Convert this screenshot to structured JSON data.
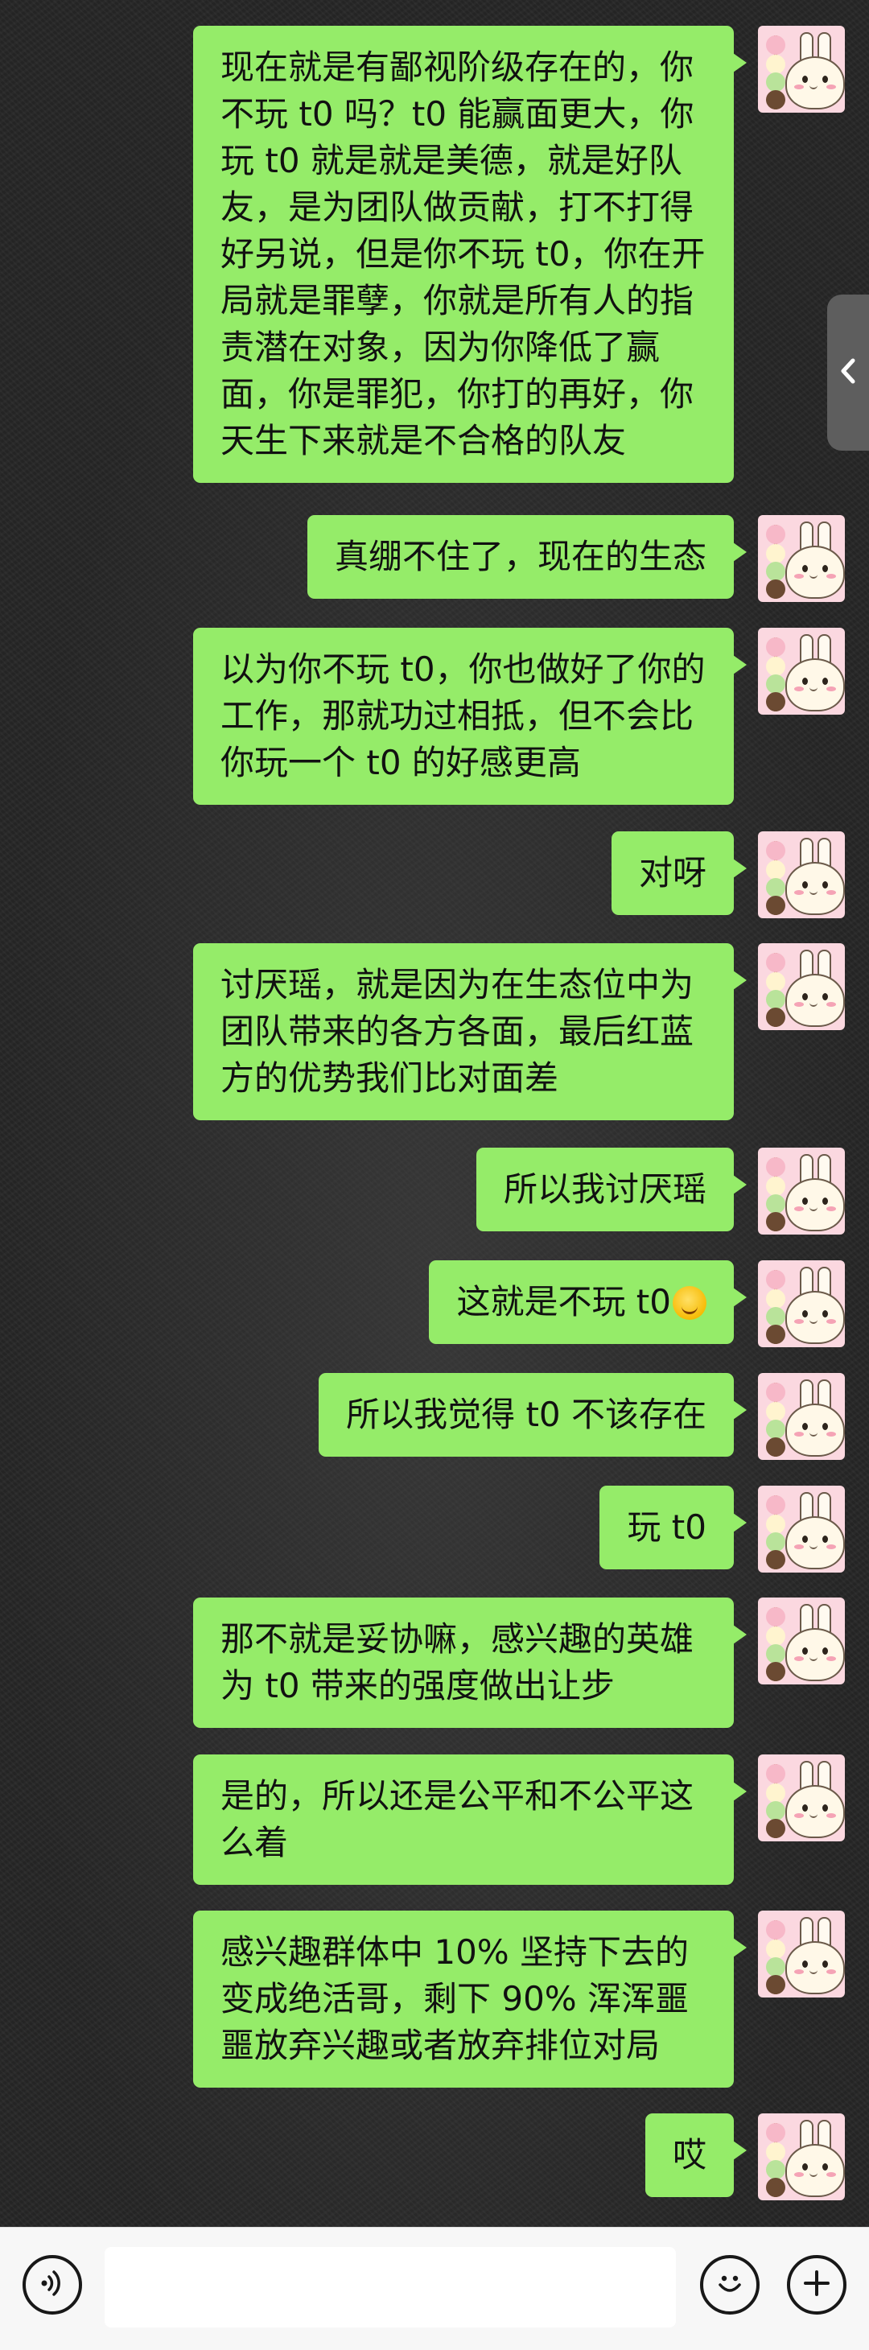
{
  "theme": {
    "bubble_color": "#95ec69",
    "avatar_bg": "#fbd8e0",
    "input_bar_bg": "#f7f7f7"
  },
  "messages": [
    {
      "text": "现在就是有鄙视阶级存在的，你不玩 t0 吗？t0 能赢面更大，你玩 t0 就是就是美德，就是好队友，是为团队做贡献，打不打得好另说，但是你不玩 t0，你在开局就是罪孽，你就是所有人的指责潜在对象，因为你降低了赢面，你是罪犯，你打的再好，你天生下来就是不合格的队友"
    },
    {
      "text": "真绷不住了，现在的生态"
    },
    {
      "text": "以为你不玩 t0，你也做好了你的工作，那就功过相抵，但不会比你玩一个 t0 的好感更高"
    },
    {
      "text": "对呀"
    },
    {
      "text": "讨厌瑶，就是因为在生态位中为团队带来的各方各面，最后红蓝方的优势我们比对面差"
    },
    {
      "text": "所以我讨厌瑶"
    },
    {
      "text": "这就是不玩 t0",
      "emoji": "yum-face-emoji"
    },
    {
      "text": "所以我觉得 t0 不该存在"
    },
    {
      "text": "玩 t0"
    },
    {
      "text": "那不就是妥协嘛，感兴趣的英雄为 t0 带来的强度做出让步"
    },
    {
      "text": "是的，所以还是公平和不公平这么着"
    },
    {
      "text": "感兴趣群体中 10% 坚持下去的变成绝活哥，剩下 90% 浑浑噩噩放弃兴趣或者放弃排位对局"
    },
    {
      "text": "哎"
    }
  ],
  "input_bar": {
    "text_value": "",
    "voice_icon": "voice-icon",
    "emoji_icon": "smiley-icon",
    "more_icon": "plus-icon"
  },
  "side_handle": {
    "icon": "chevron-left-icon"
  }
}
